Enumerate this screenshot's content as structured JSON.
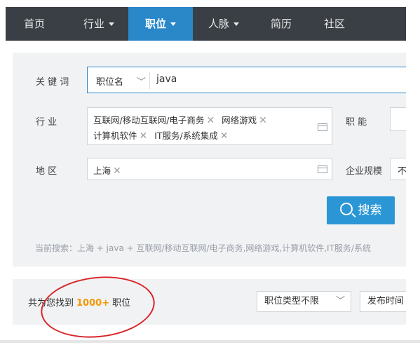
{
  "nav": {
    "items": [
      {
        "label": "首页",
        "dropdown": false,
        "active": false
      },
      {
        "label": "行业",
        "dropdown": true,
        "active": false
      },
      {
        "label": "职位",
        "dropdown": true,
        "active": true
      },
      {
        "label": "人脉",
        "dropdown": true,
        "active": false
      },
      {
        "label": "简历",
        "dropdown": false,
        "active": false
      },
      {
        "label": "社区",
        "dropdown": false,
        "active": false
      }
    ]
  },
  "search": {
    "keyword_label": "关 键 词",
    "keyword_type": "职位名",
    "keyword_value": "java",
    "industry_label": "行 业",
    "industry_tags_line1": [
      "互联网/移动互联网/电子商务",
      "网络游戏"
    ],
    "industry_tags_line2": [
      "计算机软件",
      "IT服务/系统集成"
    ],
    "function_label": "职 能",
    "region_label": "地 区",
    "region_tags": [
      "上海"
    ],
    "company_size_label": "企业规模",
    "company_size_value": "不",
    "search_button": "搜索",
    "current_search": "当前搜索：上海 + java + 互联网/移动互联网/电子商务,网络游戏,计算机软件,IT服务/系统"
  },
  "results": {
    "prefix": "共为您找到",
    "count": "1000+",
    "suffix": "职位",
    "job_type_select": "职位类型不限",
    "publish_time_select": "发布时间"
  },
  "colors": {
    "nav_bg": "#3a3f45",
    "accent": "#2a88c9",
    "count": "#f39800",
    "annotation": "#d9262b"
  }
}
